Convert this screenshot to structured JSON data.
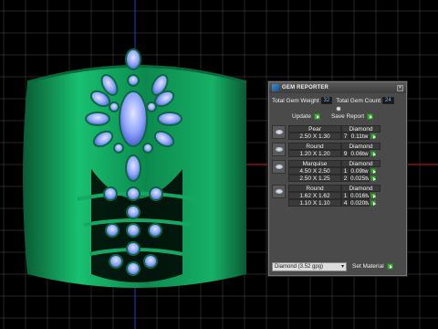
{
  "colors": {
    "grid": "#7a7a7a",
    "axis_x": "#c02020",
    "axis_y": "#1d3fbf",
    "metal": "#12a860",
    "gem": "#7f95ff",
    "setting": "#0f8a53"
  },
  "panel": {
    "title": "GEM REPORTER",
    "total_weight_label": "Total Gem Weight",
    "total_weight_value": "32",
    "total_count_label": "Total Gem Count",
    "total_count_value": "24",
    "update_label": "Update",
    "save_report_label": "Save Report",
    "gems": [
      {
        "shape": "Pear",
        "material": "Diamond",
        "rows": [
          {
            "size": "2.50 X 1.30",
            "qty": "7",
            "weight": "0.11tw"
          }
        ]
      },
      {
        "shape": "Round",
        "material": "Diamond",
        "rows": [
          {
            "size": "1.20 X 1.20",
            "qty": "9",
            "weight": "0.06tw"
          }
        ]
      },
      {
        "shape": "Marquise",
        "material": "Diamond",
        "rows": [
          {
            "size": "4.50 X 2.50",
            "qty": "1",
            "weight": "0.09tw"
          },
          {
            "size": "2.50 X 1.25",
            "qty": "2",
            "weight": "0.025tw"
          }
        ]
      },
      {
        "shape": "Round",
        "material": "Diamond",
        "rows": [
          {
            "size": "1.62 X 1.62",
            "qty": "1",
            "weight": "0.016tw"
          },
          {
            "size": "1.10 X 1.10",
            "qty": "4",
            "weight": "0.020tw"
          }
        ]
      }
    ],
    "material_select": "Diamond",
    "material_density": "(3.52 gpg)",
    "set_material_label": "Set Material"
  }
}
